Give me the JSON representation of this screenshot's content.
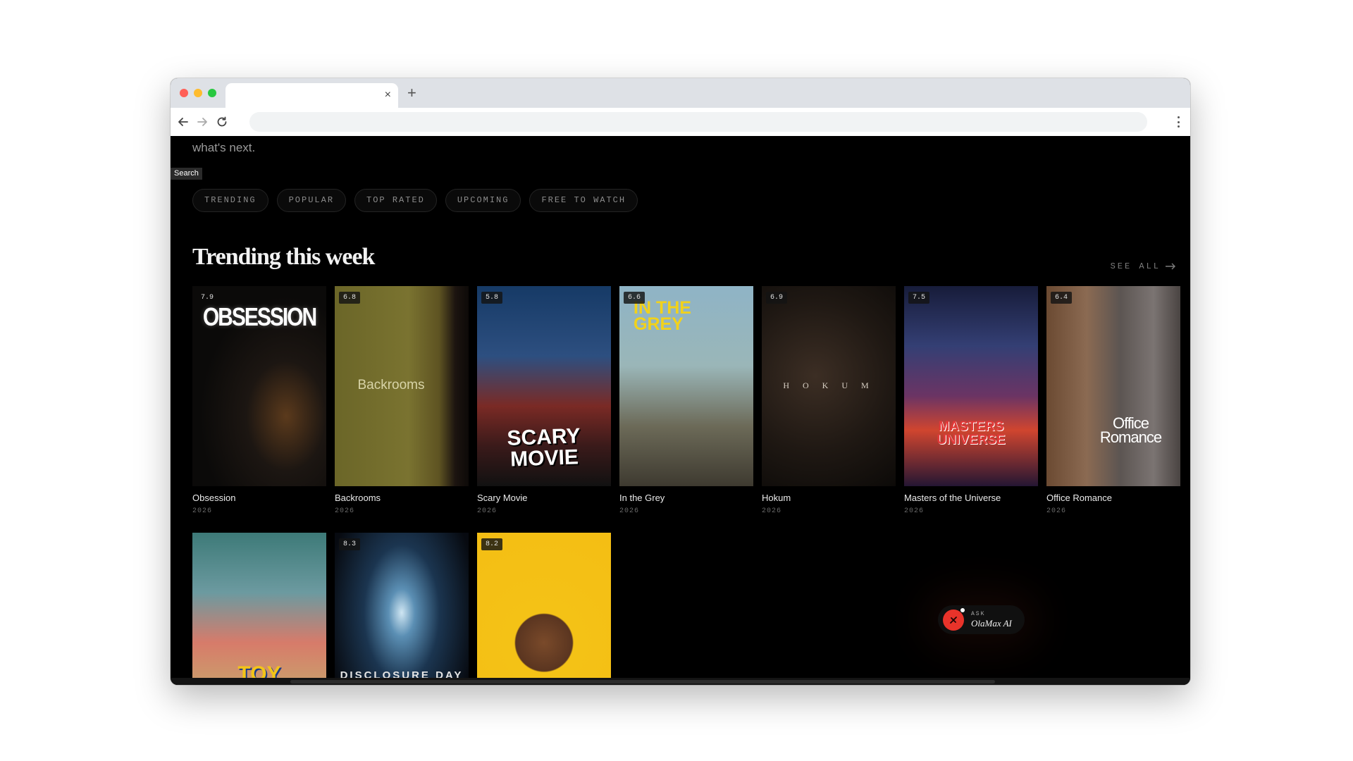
{
  "browser": {
    "tab_close": "×",
    "new_tab": "+",
    "url": ""
  },
  "page": {
    "intro_text": "what's next.",
    "search_label": "Search",
    "chips": [
      "TRENDING",
      "POPULAR",
      "TOP RATED",
      "UPCOMING",
      "FREE TO WATCH"
    ],
    "section_title": "Trending this week",
    "see_all": "SEE ALL",
    "cards": [
      {
        "title": "Obsession",
        "year": "2026",
        "rating": "7.9",
        "poster_text": "OBSESSION"
      },
      {
        "title": "Backrooms",
        "year": "2026",
        "rating": "6.8",
        "poster_text": "Backrooms"
      },
      {
        "title": "Scary Movie",
        "year": "2026",
        "rating": "5.8",
        "poster_text": "SCARY MOVIE"
      },
      {
        "title": "In the Grey",
        "year": "2026",
        "rating": "6.6",
        "poster_text": "IN THE GREY"
      },
      {
        "title": "Hokum",
        "year": "2026",
        "rating": "6.9",
        "poster_text": "H O K U M"
      },
      {
        "title": "Masters of the Universe",
        "year": "2026",
        "rating": "7.5",
        "poster_text": "MASTERS UNIVERSE"
      },
      {
        "title": "Office Romance",
        "year": "2026",
        "rating": "6.4",
        "poster_text": "Office Romance"
      },
      {
        "title": "",
        "year": "",
        "rating": "",
        "poster_text": "TOY"
      },
      {
        "title": "",
        "year": "",
        "rating": "8.3",
        "poster_text": "DISCLOSURE DAY"
      },
      {
        "title": "",
        "year": "",
        "rating": "8.2",
        "poster_text": ""
      }
    ],
    "ask_ai": {
      "top": "ASK",
      "name": "OlaMax AI"
    }
  },
  "colors": {
    "background": "#000000",
    "ai_accent": "#e8332a"
  }
}
